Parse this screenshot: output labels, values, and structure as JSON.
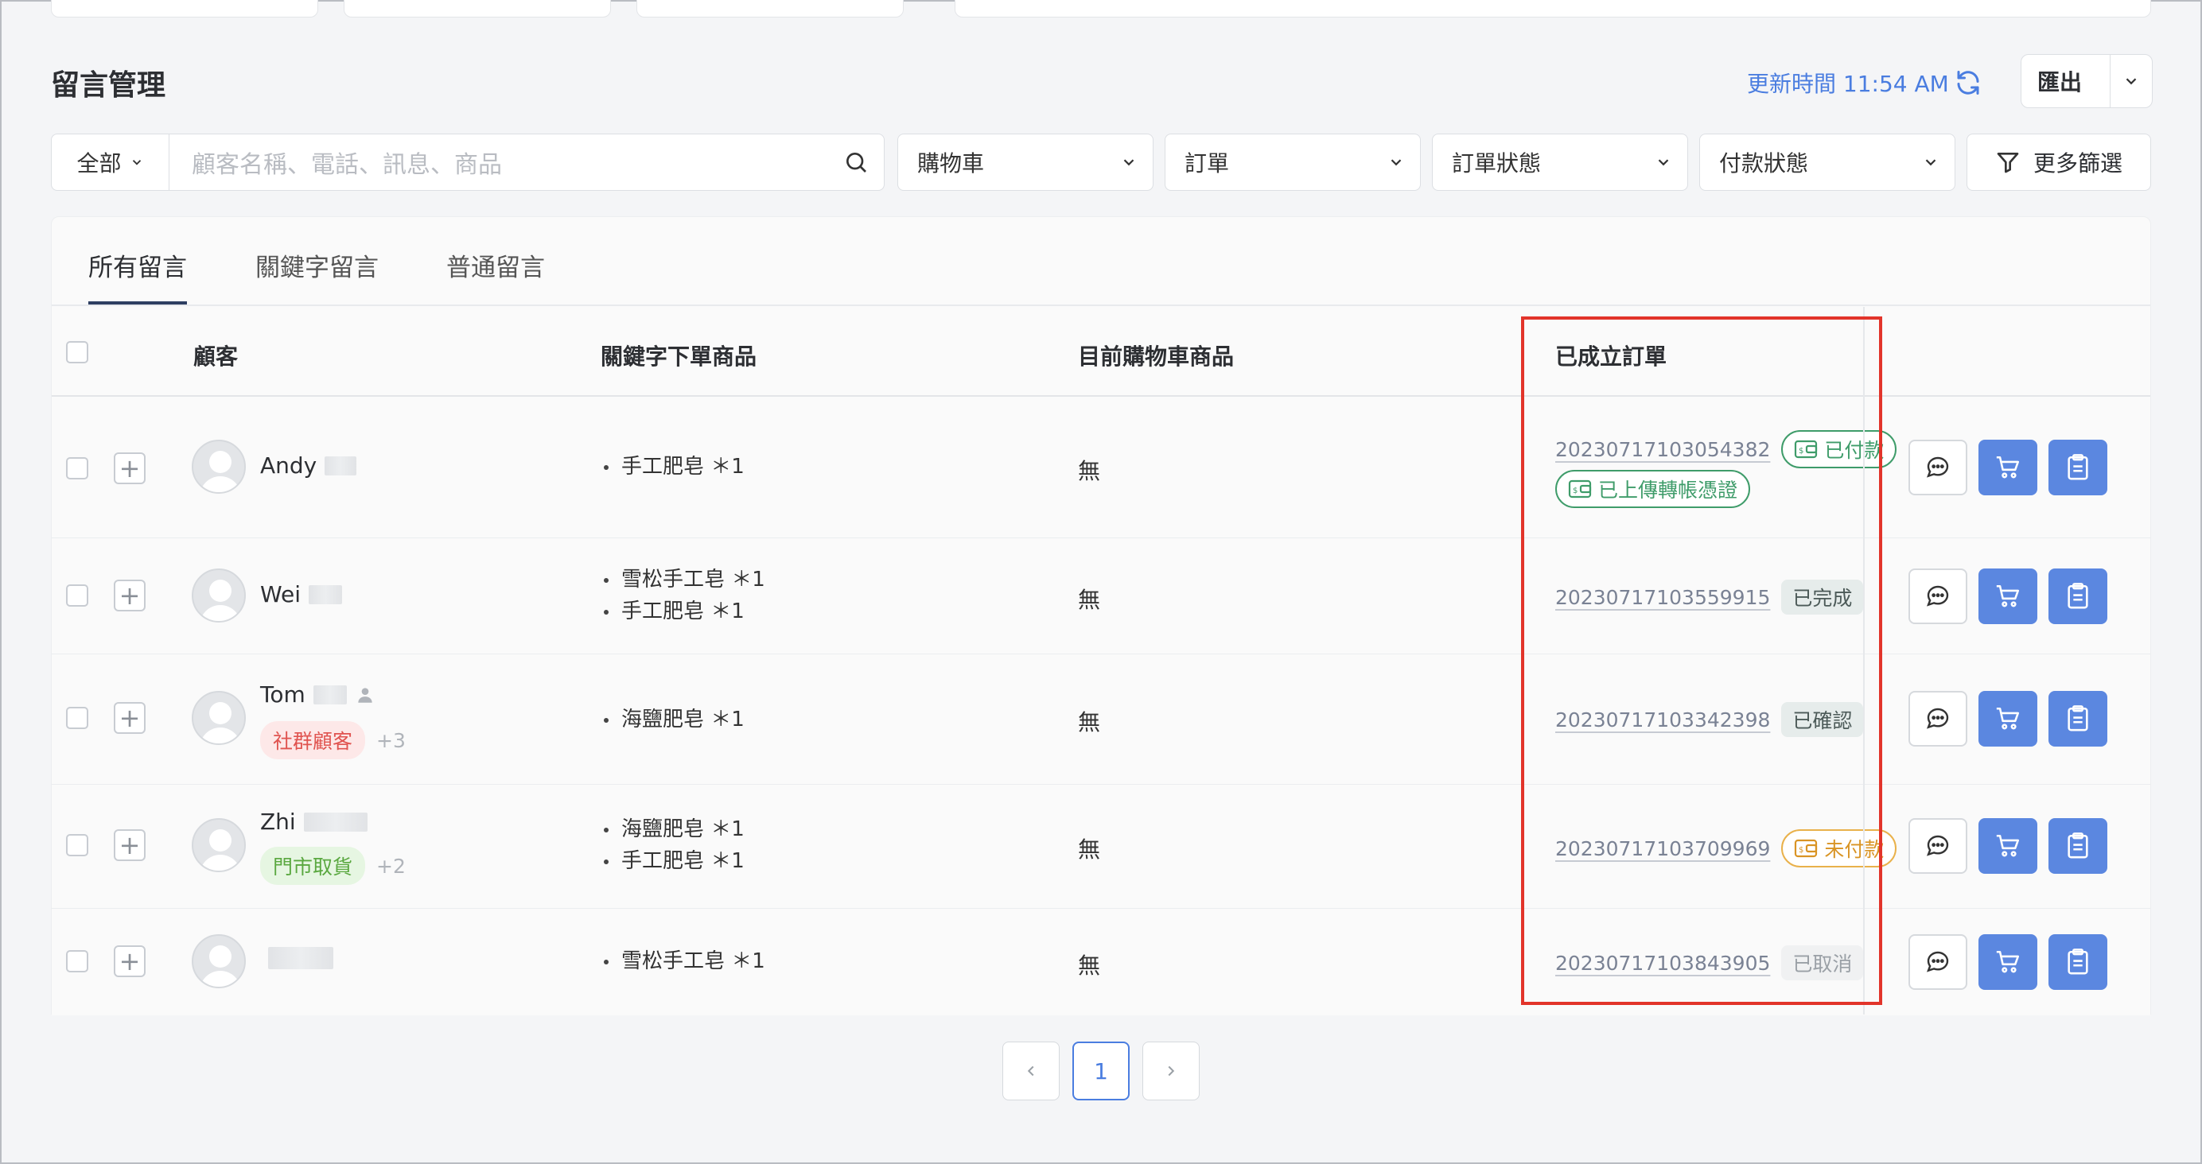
{
  "page": {
    "title": "留言管理",
    "update_time": "更新時間 11:54 AM",
    "export_label": "匯出"
  },
  "filters": {
    "scope": "全部",
    "search_placeholder": "顧客名稱、電話、訊息、商品",
    "cart": "購物車",
    "order": "訂單",
    "order_status": "訂單狀態",
    "payment_status": "付款狀態",
    "more": "更多篩選"
  },
  "tabs": [
    "所有留言",
    "關鍵字留言",
    "普通留言"
  ],
  "columns": {
    "customer": "顧客",
    "keyword_items": "關鍵字下單商品",
    "cart_items": "目前購物車商品",
    "orders": "已成立訂單"
  },
  "rows": [
    {
      "name": "Andy",
      "items": [
        "手工肥皂 ＊1"
      ],
      "cart": "無",
      "order_no": "20230717103054382",
      "badge1": "已付款",
      "badge2": "已上傳轉帳憑證"
    },
    {
      "name": "Wei",
      "items": [
        "雪松手工皂 ＊1",
        "手工肥皂 ＊1"
      ],
      "cart": "無",
      "order_no": "20230717103559915",
      "badge1": "已完成"
    },
    {
      "name": "Tom",
      "tag": "社群顧客",
      "tag_more": "+3",
      "items": [
        "海鹽肥皂 ＊1"
      ],
      "cart": "無",
      "order_no": "20230717103342398",
      "badge1": "已確認"
    },
    {
      "name": "Zhi",
      "tag": "門市取貨",
      "tag_more": "+2",
      "items": [
        "海鹽肥皂 ＊1",
        "手工肥皂 ＊1"
      ],
      "cart": "無",
      "order_no": "20230717103709969",
      "badge1": "未付款"
    },
    {
      "name": "",
      "items": [
        "雪松手工皂 ＊1"
      ],
      "cart": "無",
      "order_no": "20230717103843905",
      "badge1": "已取消"
    }
  ],
  "pagination": {
    "current": "1"
  },
  "colors": {
    "accent": "#4a7de0",
    "action_blue": "#5b87e0",
    "paid_green": "#3f9c6a",
    "unpaid_orange": "#d99424",
    "highlight_red": "#e2342a"
  }
}
